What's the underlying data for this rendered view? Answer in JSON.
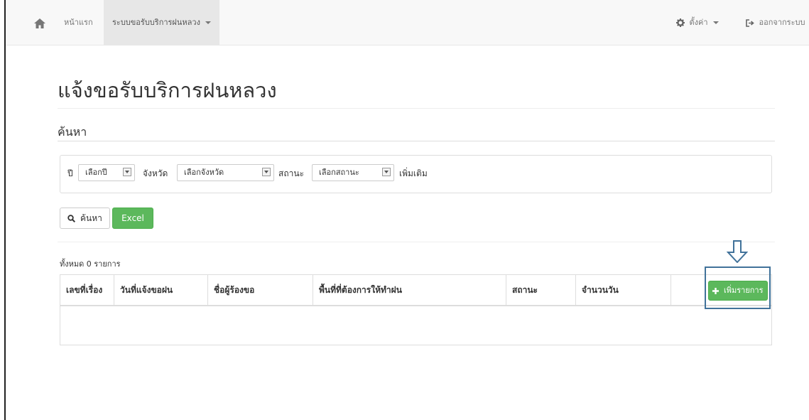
{
  "navbar": {
    "home_link": "หน้าแรก",
    "dropdown_label": "ระบบขอรับบริการฝนหลวง",
    "settings_label": "ตั้งค่า",
    "logout_label": "ออกจากระบบ"
  },
  "page": {
    "title": "แจ้งขอรับบริการฝนหลวง",
    "section_title": "ค้นหา"
  },
  "filters": {
    "year_label": "ปี",
    "year_value": "เลือกปี",
    "province_label": "จังหวัด",
    "province_value": "เลือกจังหวัด",
    "status_label": "สถานะ",
    "status_value": "เลือกสถานะ",
    "more_label": "เพิ่มเติม"
  },
  "actions": {
    "search_label": "ค้นหา",
    "excel_label": "Excel",
    "add_label": "เพิ่มรายการ"
  },
  "results": {
    "total_text": "ทั้งหมด 0 รายการ"
  },
  "table": {
    "columns": [
      "เลขที่เรื่อง",
      "วันที่แจ้งขอฝน",
      "ชื่อผู้ร้องขอ",
      "พื้นที่ที่ต้องการให้ทำฝน",
      "สถานะ",
      "จำนวนวัน"
    ],
    "rows": []
  },
  "colors": {
    "accent_green": "#5cb85c",
    "annotation_blue": "#41729a"
  },
  "icons": [
    "home-icon",
    "gear-icon",
    "logout-icon",
    "search-icon",
    "plus-icon",
    "down-arrow-annotation-icon"
  ]
}
